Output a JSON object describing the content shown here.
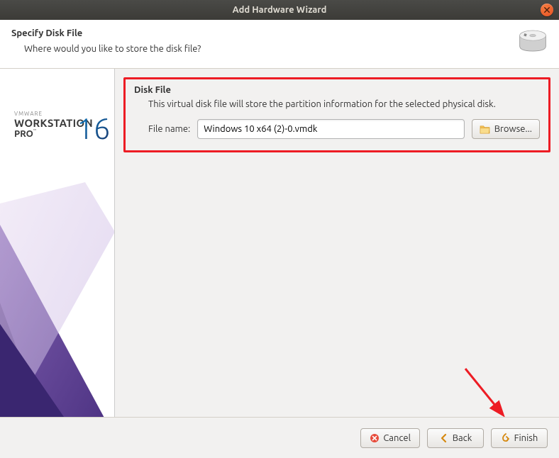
{
  "titlebar": {
    "title": "Add Hardware Wizard"
  },
  "header": {
    "title": "Specify Disk File",
    "subtitle": "Where would you like to store the disk file?"
  },
  "sidebar": {
    "brand_line1": "VMWARE",
    "brand_line2": "WORKSTATION",
    "brand_line3": "PRO",
    "version": "16"
  },
  "diskfile": {
    "section_title": "Disk File",
    "description": "This virtual disk file will store the partition information for the selected physical disk.",
    "label": "File name:",
    "value": "Windows 10 x64 (2)-0.vmdk",
    "browse_label": "Browse..."
  },
  "footer": {
    "cancel": "Cancel",
    "back": "Back",
    "finish": "Finish"
  }
}
